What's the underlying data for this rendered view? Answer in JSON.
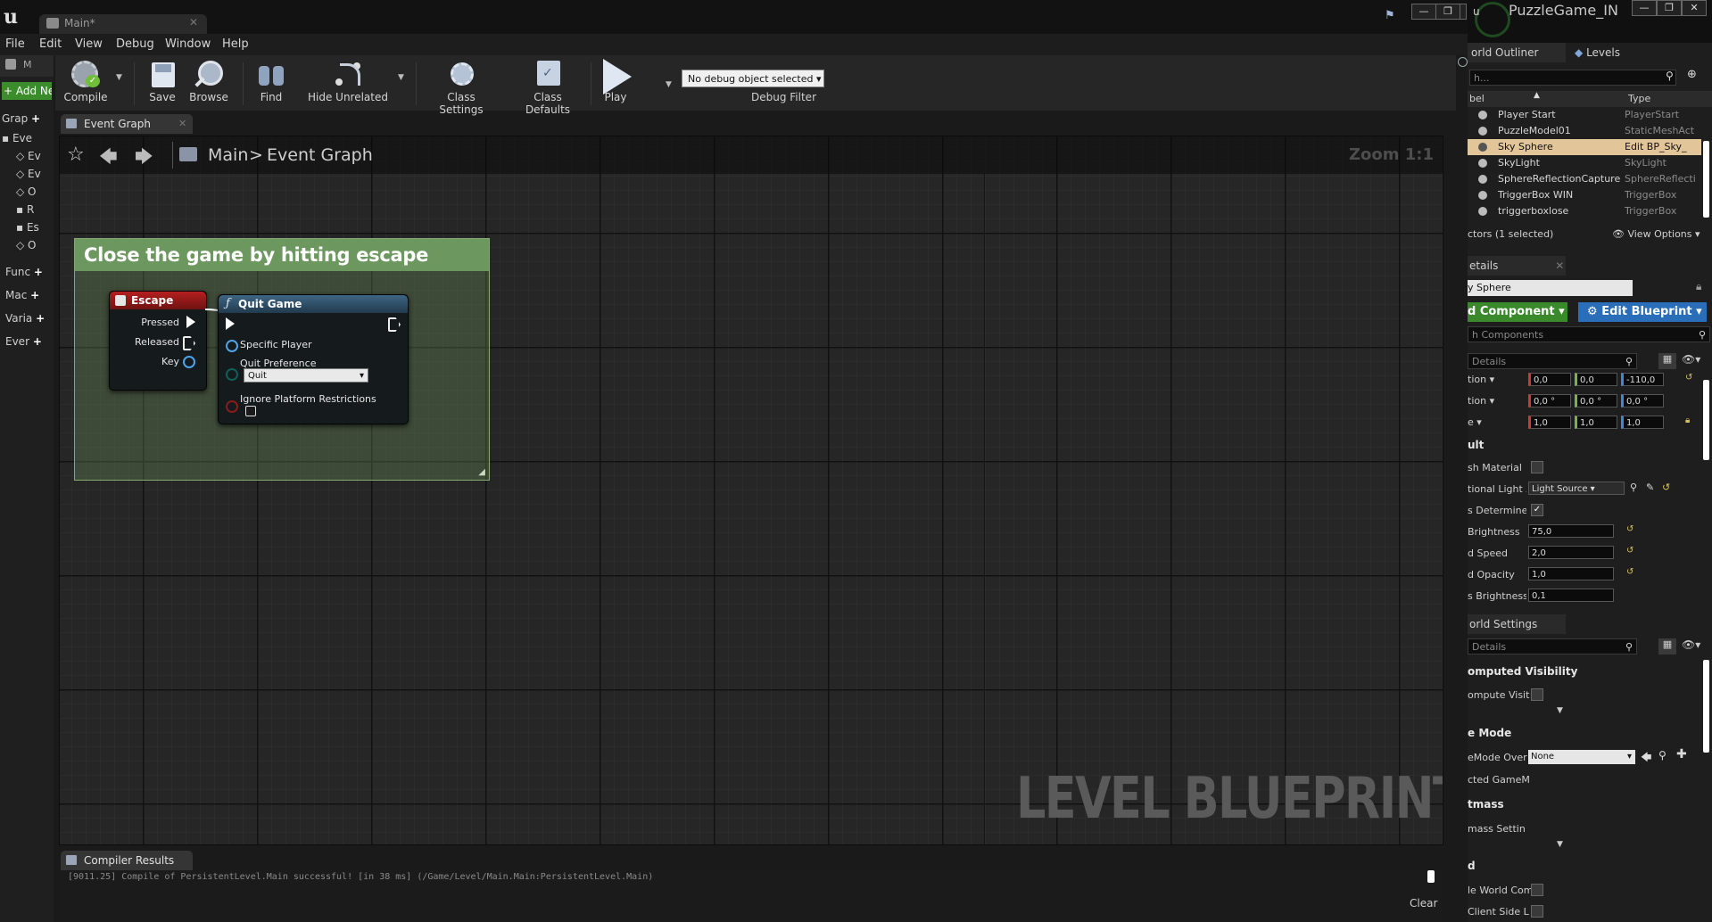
{
  "window": {
    "doc_tab": "Main*",
    "controls": [
      "—",
      "❐",
      "✕"
    ]
  },
  "menu": [
    "File",
    "Edit",
    "View",
    "Debug",
    "Window",
    "Help"
  ],
  "left_panel": {
    "tab_label": "M",
    "add_new": "+ Add Ne",
    "items": [
      "Grap",
      "Eve",
      "Ev",
      "Ev",
      "O",
      "R",
      "Es",
      "O",
      "Func",
      "Mac",
      "Varia",
      "Ever"
    ]
  },
  "toolbar": {
    "compile": "Compile",
    "save": "Save",
    "browse": "Browse",
    "find": "Find",
    "hide_unrelated": "Hide Unrelated",
    "class_settings": "Class Settings",
    "class_defaults": "Class Defaults",
    "play": "Play",
    "debug_object": "No debug object selected",
    "debug_filter": "Debug Filter"
  },
  "graph": {
    "tab": "Event Graph",
    "breadcrumb_root": "Main",
    "breadcrumb_sep": ">",
    "breadcrumb_leaf": "Event Graph",
    "zoom": "Zoom 1:1",
    "watermark": "LEVEL BLUEPRINT",
    "comment_title": "Close the game by hitting escape",
    "escape_node": {
      "title": "Escape",
      "pins": [
        "Pressed",
        "Released",
        "Key"
      ]
    },
    "quit_node": {
      "title": "Quit Game",
      "specific_player": "Specific Player",
      "quit_preference": "Quit Preference",
      "quit_value": "Quit",
      "ignore_platform": "Ignore Platform Restrictions"
    }
  },
  "compiler": {
    "tab": "Compiler Results",
    "log": "[9011.25] Compile of PersistentLevel.Main successful! [in 38 ms] (/Game/Level/Main.Main:PersistentLevel.Main)",
    "clear": "Clear"
  },
  "right_panel": {
    "title": "PuzzleGame_IN",
    "tabs": {
      "outliner": "orld Outliner",
      "levels": "Levels"
    },
    "search_placeholder": "h...",
    "col_label": "bel",
    "col_type": "Type",
    "actors": [
      {
        "label": "Player Start",
        "type": "PlayerStart"
      },
      {
        "label": "PuzzleModel01",
        "type": "StaticMeshAct"
      },
      {
        "label": "Sky Sphere",
        "type": "Edit BP_Sky_"
      },
      {
        "label": "SkyLight",
        "type": "SkyLight"
      },
      {
        "label": "SphereReflectionCapture",
        "type": "SphereReflecti"
      },
      {
        "label": "TriggerBox WIN",
        "type": "TriggerBox"
      },
      {
        "label": "triggerboxlose",
        "type": "TriggerBox"
      }
    ],
    "actors_selected": "ctors (1 selected)",
    "view_options": "View Options",
    "details": {
      "tab": "etails",
      "name_value": "y Sphere",
      "add_component": "d Component",
      "edit_blueprint": "Edit Blueprint",
      "search_components": "h Components",
      "search_details": " Details",
      "transform": [
        {
          "label": "tion",
          "values": [
            "0,0",
            "0,0",
            "-110,0"
          ]
        },
        {
          "label": "tion",
          "values": [
            "0,0 °",
            "0,0 °",
            "0,0 °"
          ]
        },
        {
          "label": "e",
          "values": [
            "1,0",
            "1,0",
            "1,0"
          ]
        }
      ],
      "default_section": "ult",
      "props": [
        {
          "label": "sh Material",
          "kind": "check",
          "value": ""
        },
        {
          "label": "tional Light A",
          "kind": "select",
          "value": "Light Source"
        },
        {
          "label": "s Determine",
          "kind": "checked",
          "value": ""
        },
        {
          "label": "Brightness",
          "kind": "num",
          "value": "75,0"
        },
        {
          "label": "d Speed",
          "kind": "num",
          "value": "2,0"
        },
        {
          "label": "d Opacity",
          "kind": "num",
          "value": "1,0"
        },
        {
          "label": "s Brightness",
          "kind": "num",
          "value": "0,1"
        }
      ]
    },
    "world_settings": {
      "tab": "orld Settings",
      "search_details": " Details",
      "precomputed": "omputed Visibility",
      "precompute_label": "ompute Visit",
      "game_mode": "e Mode",
      "gamemode_override": "eMode Over",
      "gamemode_value": "None",
      "selected_gamemode": "cted GameM",
      "lightmass": "tmass",
      "lightmass_settings": "mass Settin",
      "world": "d",
      "world_comp": "le World Com",
      "client_side": "Client Side L"
    }
  }
}
